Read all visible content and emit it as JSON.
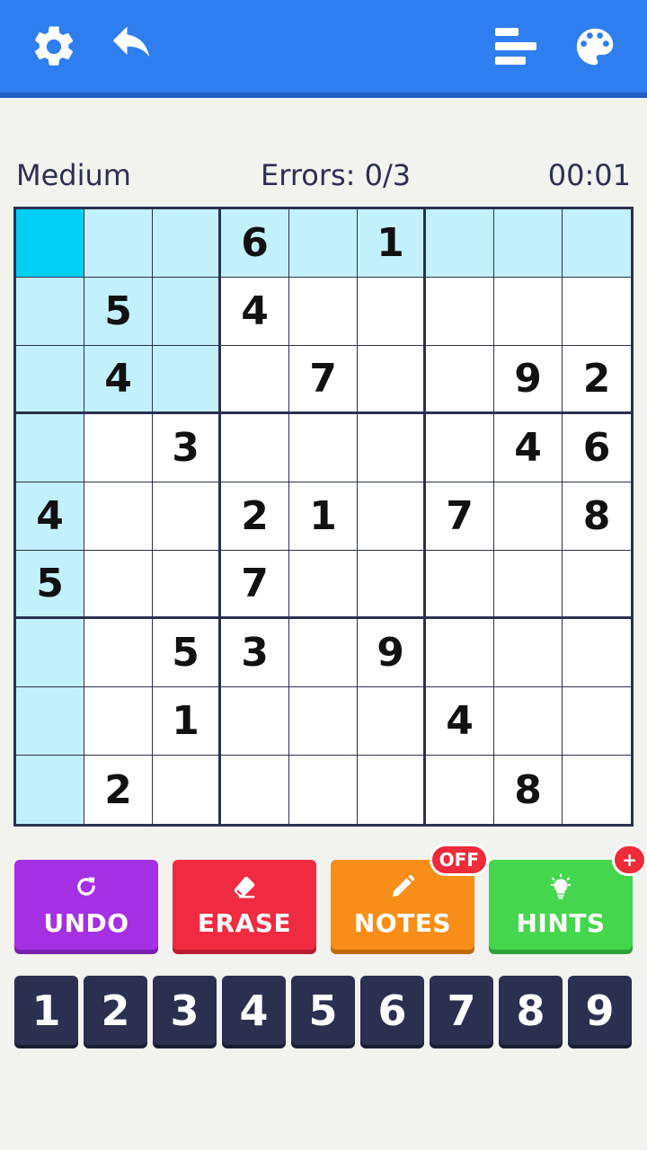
{
  "toolbar": {
    "icons": [
      "gear-icon",
      "undo-arrow-icon",
      "leaderboard-icon",
      "palette-icon"
    ]
  },
  "status": {
    "difficulty": "Medium",
    "errors": "Errors: 0/3",
    "timer": "00:01"
  },
  "board": {
    "selected": [
      0,
      0
    ],
    "cells": [
      [
        "",
        "",
        "",
        "6",
        "",
        "1",
        "",
        "",
        ""
      ],
      [
        "",
        "5",
        "",
        "4",
        "",
        "",
        "",
        "",
        ""
      ],
      [
        "",
        "4",
        "",
        "",
        "7",
        "",
        "",
        "9",
        "2"
      ],
      [
        "",
        "",
        "3",
        "",
        "",
        "",
        "",
        "4",
        "6"
      ],
      [
        "4",
        "",
        "",
        "2",
        "1",
        "",
        "7",
        "",
        "8"
      ],
      [
        "5",
        "",
        "",
        "7",
        "",
        "",
        "",
        "",
        ""
      ],
      [
        "",
        "",
        "5",
        "3",
        "",
        "9",
        "",
        "",
        ""
      ],
      [
        "",
        "",
        "1",
        "",
        "",
        "",
        "4",
        "",
        ""
      ],
      [
        "",
        "2",
        "",
        "",
        "",
        "",
        "",
        "8",
        ""
      ]
    ]
  },
  "actions": [
    {
      "label": "UNDO",
      "icon": "refresh-icon",
      "color": "#a52fe3",
      "shadow": "#7a1fb0"
    },
    {
      "label": "ERASE",
      "icon": "eraser-icon",
      "color": "#f02a40",
      "shadow": "#b81c2e"
    },
    {
      "label": "NOTES",
      "icon": "pencil-icon",
      "color": "#f88e18",
      "shadow": "#c06a0c",
      "badge": "OFF"
    },
    {
      "label": "HINTS",
      "icon": "lightbulb-icon",
      "color": "#44d64c",
      "shadow": "#2ea335",
      "badge": "+"
    }
  ],
  "numpad": [
    "1",
    "2",
    "3",
    "4",
    "5",
    "6",
    "7",
    "8",
    "9"
  ]
}
